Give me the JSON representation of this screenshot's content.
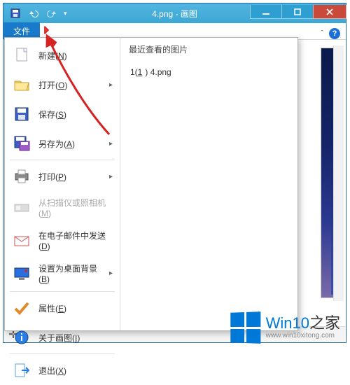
{
  "window": {
    "title": "4.png - 画图",
    "file_tab": "文件"
  },
  "menu": {
    "new": "新建(N)",
    "open": "打开(O)",
    "save": "保存(S)",
    "save_as": "另存为(A)",
    "print": "打印(P)",
    "scanner": "从扫描仪或照相机(M)",
    "email": "在电子邮件中发送(D)",
    "wallpaper": "设置为桌面背景(B)",
    "properties": "属性(E)",
    "about": "关于画图(I)",
    "exit": "退出(X)"
  },
  "recent": {
    "title": "最近查看的图片",
    "items": [
      {
        "key": "1",
        "ukey": "1",
        "name": "4.png"
      }
    ]
  },
  "watermark": {
    "brand_a": "Win10",
    "brand_b": "之家",
    "url": "www.win10xitong.com"
  }
}
